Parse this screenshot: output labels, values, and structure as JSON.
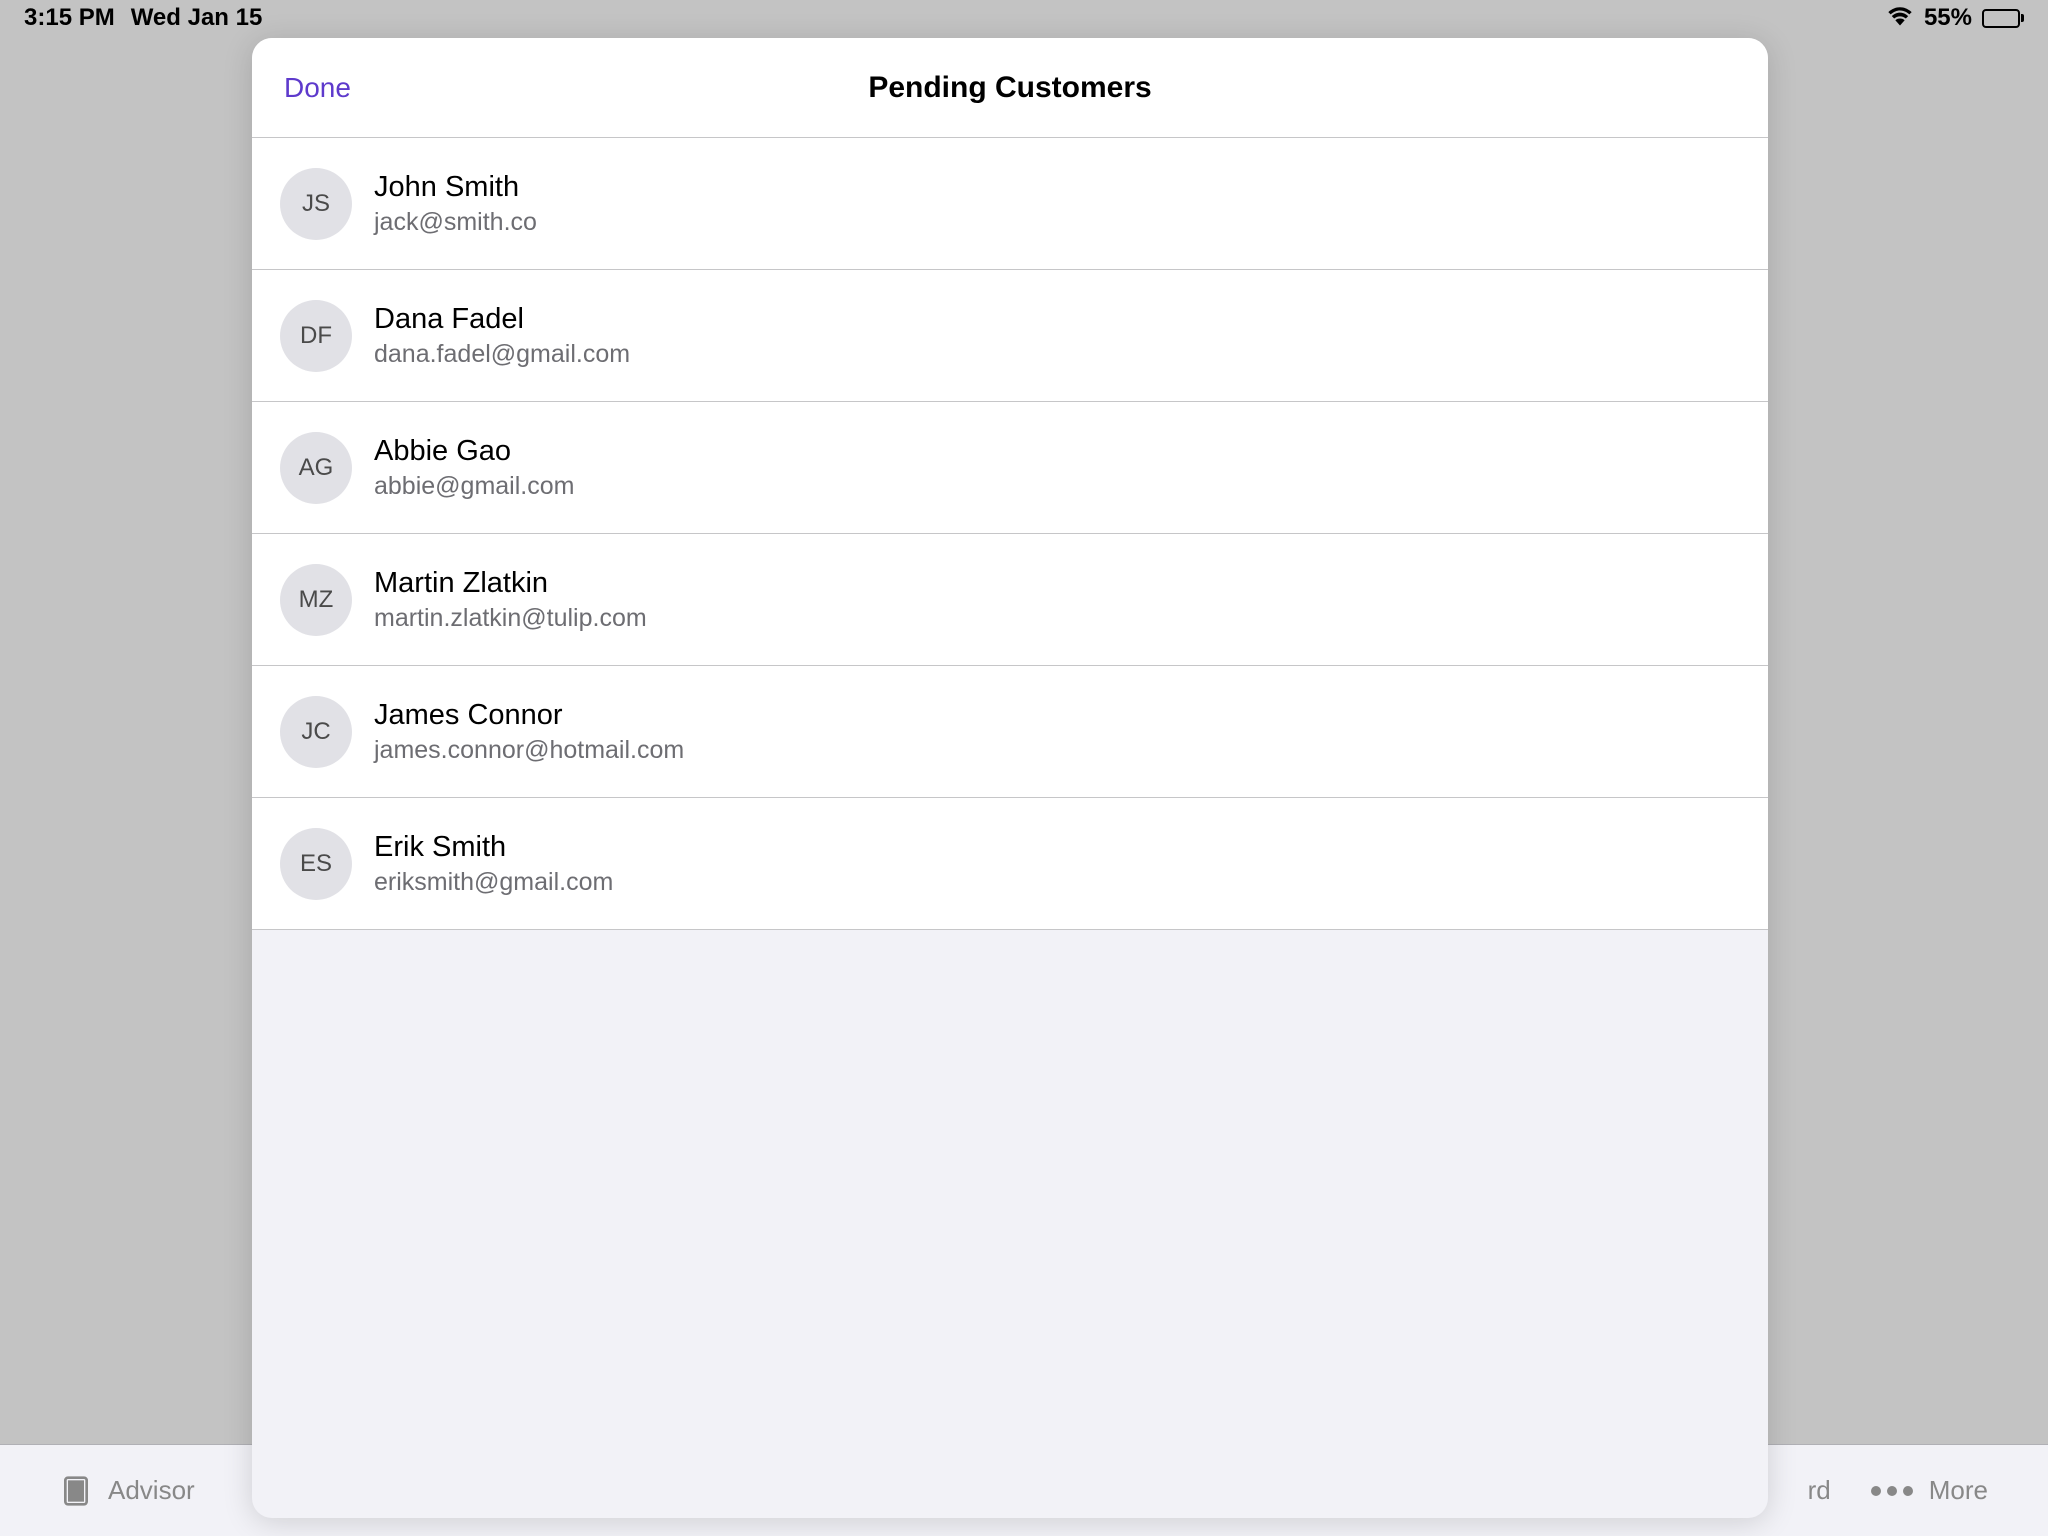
{
  "statusBar": {
    "time": "3:15 PM",
    "date": "Wed Jan 15",
    "batteryPercent": "55%"
  },
  "modal": {
    "doneLabel": "Done",
    "title": "Pending Customers"
  },
  "customers": [
    {
      "initials": "JS",
      "name": "John Smith",
      "email": "jack@smith.co"
    },
    {
      "initials": "DF",
      "name": "Dana Fadel",
      "email": "dana.fadel@gmail.com"
    },
    {
      "initials": "AG",
      "name": "Abbie Gao",
      "email": "abbie@gmail.com"
    },
    {
      "initials": "MZ",
      "name": "Martin Zlatkin",
      "email": "martin.zlatkin@tulip.com"
    },
    {
      "initials": "JC",
      "name": "James Connor",
      "email": "james.connor@hotmail.com"
    },
    {
      "initials": "ES",
      "name": "Erik Smith",
      "email": "eriksmith@gmail.com"
    }
  ],
  "toolbar": {
    "leftLabel": "Advisor",
    "rightPartial": "rd",
    "moreLabel": "More"
  }
}
